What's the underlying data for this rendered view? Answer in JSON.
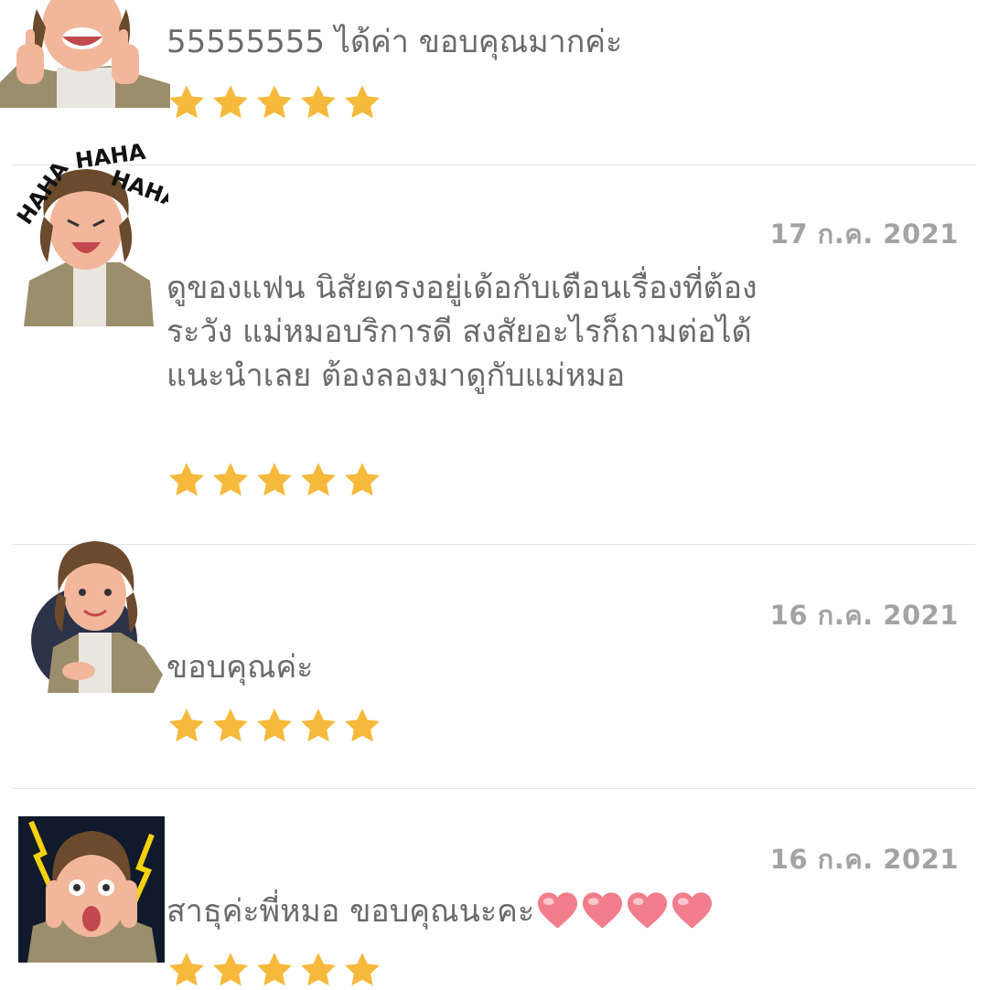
{
  "reviews": [
    {
      "date": "",
      "text": "55555555 ได้ค่า ขอบคุณมากค่ะ",
      "rating": 5,
      "avatar": "avatar-thumbs-up-icon"
    },
    {
      "date": "17 ก.ค. 2021",
      "text": "ดูของแฟน นิสัยตรงอยู่เด้อกับเตือนเรื่องที่ต้องระวัง แม่หมอบริการดี สงสัยอะไรก็ถามต่อได้ แนะนำเลย ต้องลองมาดูกับแม่หมอ",
      "rating": 5,
      "avatar": "avatar-laughing-icon",
      "sticker_text": "HAHA"
    },
    {
      "date": "16 ก.ค. 2021",
      "text": "ขอบคุณค่ะ",
      "rating": 5,
      "avatar": "avatar-smiling-icon"
    },
    {
      "date": "16 ก.ค. 2021",
      "text": "สาธุค่ะพี่หมอ ขอบคุณนะคะ",
      "rating": 5,
      "avatar": "avatar-shocked-icon",
      "emoji": "heart-icon",
      "emoji_count": 4
    }
  ],
  "colors": {
    "star": "#f6b93b",
    "heart": "#f27d8c",
    "divider": "#e4e4e4",
    "date": "#a3a3a3",
    "text": "#6a6a6a"
  }
}
